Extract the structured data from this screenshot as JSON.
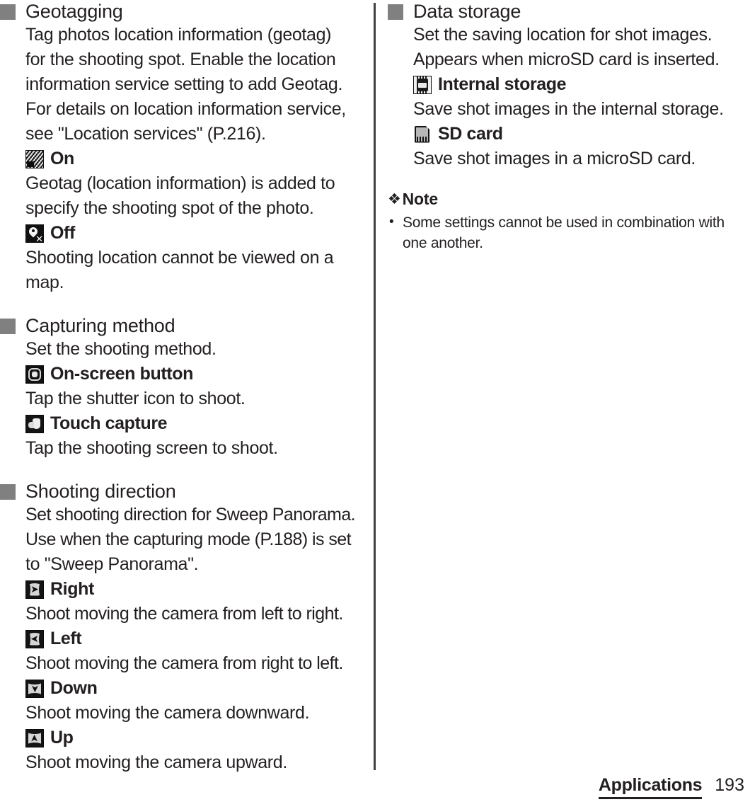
{
  "page": {
    "footer_section": "Applications",
    "footer_page_number": "193"
  },
  "left_column": {
    "sections": [
      {
        "title": "Geotagging",
        "paragraphs": [
          "Tag photos location information (geotag)",
          "for the shooting spot. Enable the location",
          "information service setting to add Geotag.",
          "For details on location information service,",
          "see \"Location services\" (P.216)."
        ],
        "options": [
          {
            "icon": "geotag-on-icon",
            "label": "On",
            "description": [
              "Geotag (location information) is added to",
              "specify the shooting spot of the photo."
            ]
          },
          {
            "icon": "geotag-off-icon",
            "label": "Off",
            "description": [
              "Shooting location cannot be viewed on a",
              "map."
            ]
          }
        ]
      },
      {
        "title": "Capturing method",
        "paragraphs": [
          "Set the shooting method."
        ],
        "options": [
          {
            "icon": "on-screen-button-icon",
            "label": "On-screen button",
            "description": [
              "Tap the shutter icon to shoot."
            ]
          },
          {
            "icon": "touch-capture-icon",
            "label": "Touch capture",
            "description": [
              "Tap the shooting screen to shoot."
            ]
          }
        ]
      },
      {
        "title": "Shooting direction",
        "paragraphs": [
          "Set shooting direction for Sweep Panorama.",
          "Use when the capturing mode (P.188) is set",
          "to \"Sweep Panorama\"."
        ],
        "options": [
          {
            "icon": "direction-right-icon",
            "label": "Right",
            "description": [
              "Shoot moving the camera from left to right."
            ]
          },
          {
            "icon": "direction-left-icon",
            "label": "Left",
            "description": [
              "Shoot moving the camera from right to left."
            ]
          },
          {
            "icon": "direction-down-icon",
            "label": "Down",
            "description": [
              "Shoot moving the camera downward."
            ]
          },
          {
            "icon": "direction-up-icon",
            "label": "Up",
            "description": [
              "Shoot moving the camera upward."
            ]
          }
        ]
      }
    ]
  },
  "right_column": {
    "sections": [
      {
        "title": "Data storage",
        "paragraphs": [
          "Set the saving location for shot images.",
          "Appears when microSD card is inserted."
        ],
        "options": [
          {
            "icon": "internal-storage-icon",
            "label": "Internal storage",
            "description": [
              "Save shot images in the internal storage."
            ]
          },
          {
            "icon": "sd-card-icon",
            "label": "SD card",
            "description": [
              "Save shot images in a microSD card."
            ]
          }
        ]
      }
    ],
    "note": {
      "diamond_glyph": "❖",
      "heading": "Note",
      "items": [
        "Some settings cannot be used in combination with one another."
      ]
    }
  }
}
